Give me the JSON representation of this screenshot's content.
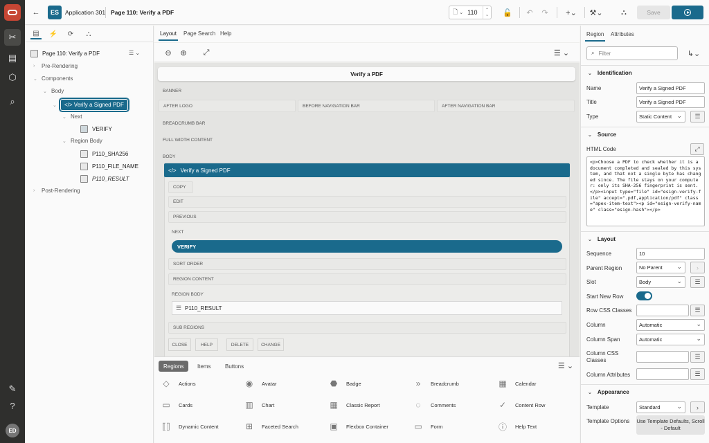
{
  "rail": {
    "logo": "oracle-logo",
    "items": [
      "app-builder-icon",
      "sql-workshop-icon",
      "packaged-apps-icon",
      "search-icon"
    ],
    "bottom": [
      "user-edit-icon",
      "help-icon"
    ],
    "avatar": "ED"
  },
  "topbar": {
    "app_badge": "ES",
    "app_title": "Application 301",
    "page_title": "Page 110: Verify a PDF",
    "page_number": "110",
    "save_label": "Save"
  },
  "left": {
    "tree": {
      "page": "Page 110: Verify a PDF",
      "pre_rendering": "Pre-Rendering",
      "components": "Components",
      "body": "Body",
      "selected": "Verify a Signed PDF",
      "next": "Next",
      "verify": "VERIFY",
      "region_body": "Region Body",
      "item1": "P110_SHA256",
      "item2": "P110_FILE_NAME",
      "item3": "P110_RESULT",
      "post_rendering": "Post-Rendering"
    }
  },
  "center": {
    "tabs": [
      "Layout",
      "Page Search",
      "Help"
    ],
    "page_title": "Verify a PDF",
    "slots": {
      "banner": "BANNER",
      "after_logo": "AFTER LOGO",
      "before_nav": "BEFORE NAVIGATION BAR",
      "after_nav": "AFTER NAVIGATION BAR",
      "breadcrumb": "BREADCRUMB BAR",
      "full_width": "FULL WIDTH CONTENT",
      "body": "BODY"
    },
    "region": {
      "title": "Verify a Signed PDF",
      "copy": "COPY",
      "edit": "EDIT",
      "previous": "PREVIOUS",
      "next": "NEXT",
      "verify": "VERIFY",
      "sort_order": "SORT ORDER",
      "region_content": "REGION CONTENT",
      "region_body": "REGION BODY",
      "result_item": "P110_RESULT",
      "sub_regions": "SUB REGIONS",
      "buttons": [
        "CLOSE",
        "HELP",
        "DELETE",
        "CHANGE"
      ]
    }
  },
  "gallery": {
    "tabs": [
      "Regions",
      "Items",
      "Buttons"
    ],
    "items": [
      [
        "Actions",
        "Avatar",
        "Badge",
        "Breadcrumb",
        "Calendar"
      ],
      [
        "Cards",
        "Chart",
        "Classic Report",
        "Comments",
        "Content Row"
      ],
      [
        "Dynamic Content",
        "Faceted Search",
        "Flexbox Container",
        "Form",
        "Help Text"
      ]
    ]
  },
  "props": {
    "tabs": [
      "Region",
      "Attributes"
    ],
    "filter_placeholder": "Filter",
    "identification": {
      "heading": "Identification",
      "name_label": "Name",
      "name_value": "Verify a Signed PDF",
      "title_label": "Title",
      "title_value": "Verify a Signed PDF",
      "type_label": "Type",
      "type_value": "Static Content"
    },
    "source": {
      "heading": "Source",
      "html_code_label": "HTML Code",
      "html_code": "<p>Choose a PDF to check whether it is a document completed and sealed by this system, and that not a single byte has changed since. The file stays on your computer: only its SHA-256 fingerprint is sent.</p><input type=\"file\" id=\"esign-verify-file\" accept=\".pdf,application/pdf\" class=\"apex-item-text\"><p id=\"esign-verify-name\" class=\"esign-hash\"></p>"
    },
    "layout": {
      "heading": "Layout",
      "sequence_label": "Sequence",
      "sequence_value": "10",
      "parent_label": "Parent Region",
      "parent_value": "No Parent",
      "slot_label": "Slot",
      "slot_value": "Body",
      "start_new_row_label": "Start New Row",
      "row_css_label": "Row CSS Classes",
      "column_label": "Column",
      "column_value": "Automatic",
      "column_span_label": "Column Span",
      "column_span_value": "Automatic",
      "column_css_label": "Column CSS Classes",
      "column_attr_label": "Column Attributes"
    },
    "appearance": {
      "heading": "Appearance",
      "template_label": "Template",
      "template_value": "Standard",
      "template_options_label": "Template Options",
      "template_options_value": "Use Template Defaults, Scroll - Default"
    }
  }
}
